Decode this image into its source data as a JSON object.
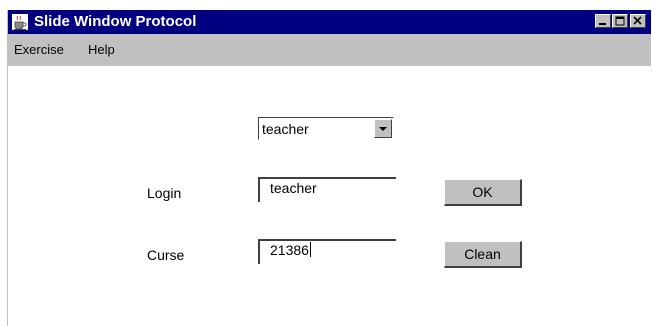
{
  "window": {
    "title": "Slide Window Protocol",
    "icon": "java-coffee-cup-icon",
    "controls": [
      "minimize-icon",
      "maximize-icon",
      "close-icon"
    ]
  },
  "menubar": {
    "items": [
      {
        "label": "Exercise"
      },
      {
        "label": "Help"
      }
    ]
  },
  "form": {
    "role_select": {
      "value": "teacher"
    },
    "login": {
      "label": "Login",
      "value": "teacher"
    },
    "curse": {
      "label": "Curse",
      "value": "21386"
    },
    "ok_label": "OK",
    "clean_label": "Clean"
  },
  "colors": {
    "titlebar": "#000080",
    "face": "#c0c0c0",
    "background": "#ffffff"
  }
}
